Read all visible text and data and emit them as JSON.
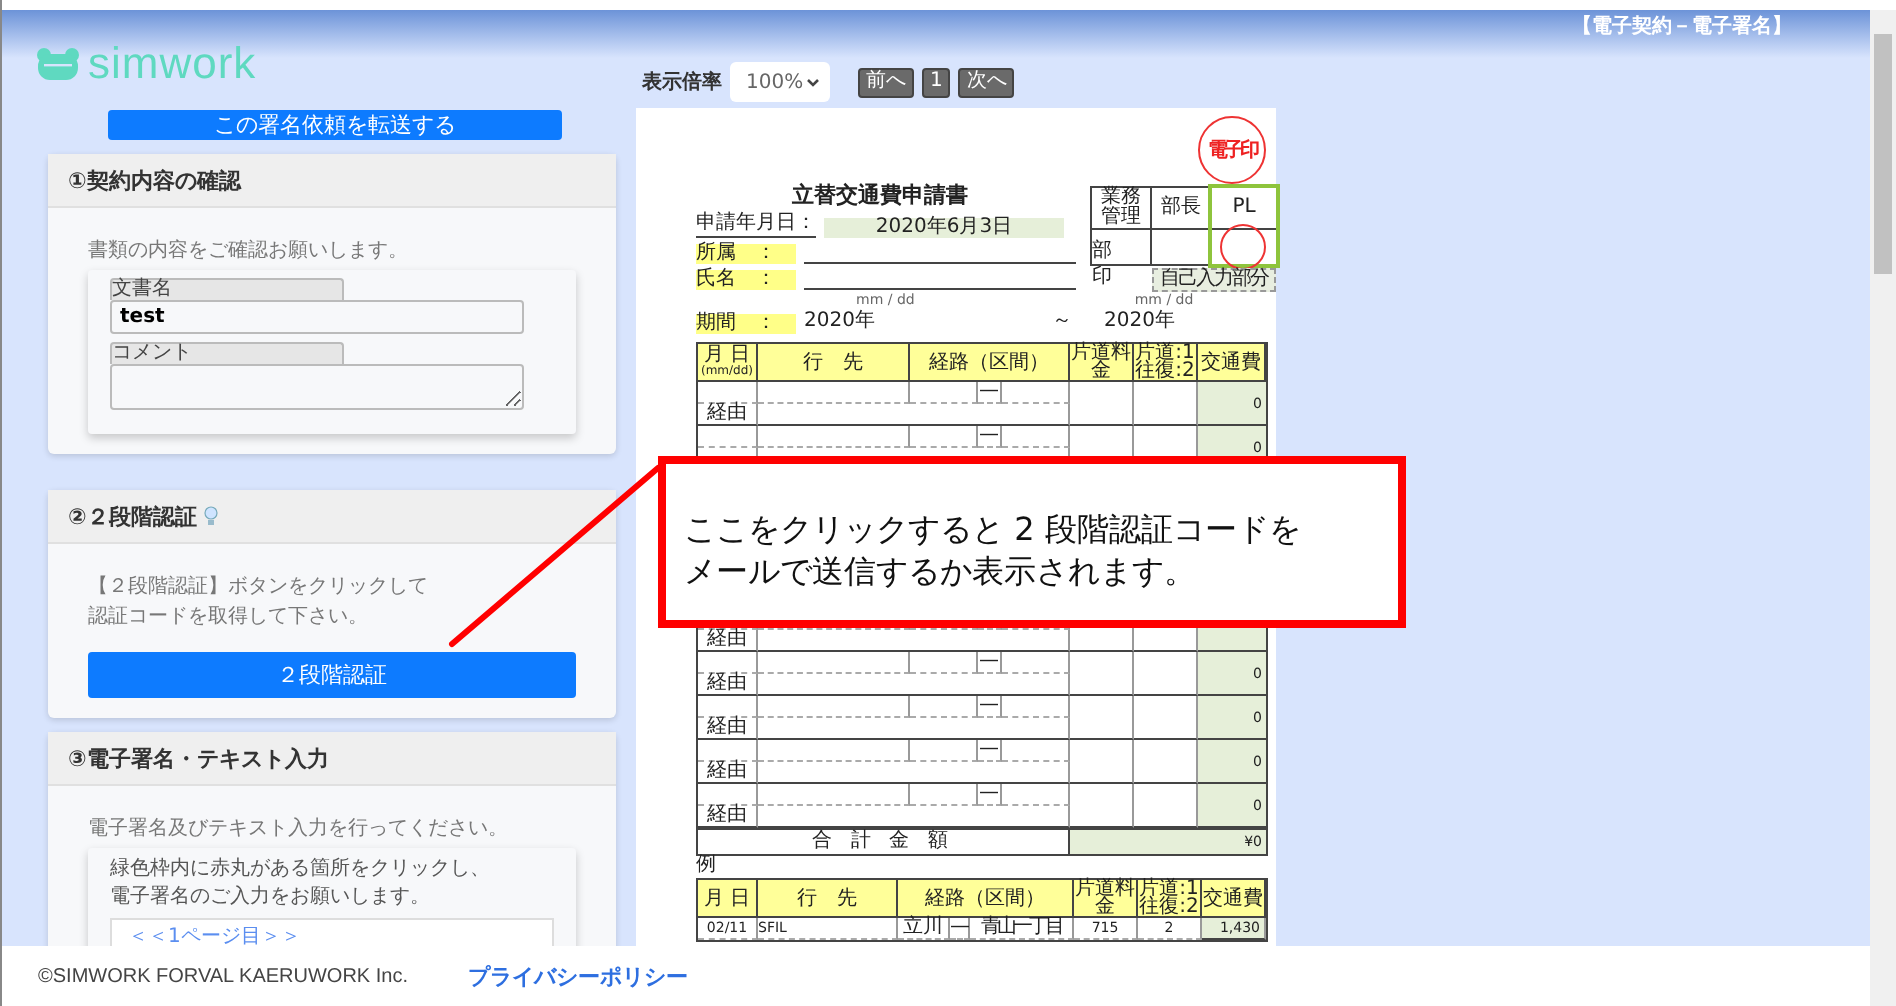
{
  "header": {
    "title": "【電子契約－電子署名】"
  },
  "logo": {
    "text": "simwork"
  },
  "transfer_button": "この署名依頼を転送する",
  "sections": [
    {
      "kind": "contract",
      "title": "①契約内容の確認",
      "intro": "書類の内容をご確認お願いします。",
      "fields": [
        {
          "label": "文書名",
          "value": "test"
        },
        {
          "label": "コメント"
        }
      ]
    },
    {
      "kind": "twofactor",
      "title": "②２段階認証",
      "lines": [
        "【２段階認証】ボタンをクリックして",
        "認証コードを取得して下さい。"
      ],
      "button": "２段階認証"
    },
    {
      "kind": "signature",
      "title": "③電子署名・テキスト入力",
      "intro": "電子署名及びテキスト入力を行ってください。",
      "notes": [
        "緑色枠内に赤丸がある箇所をクリックし、",
        "電子署名のご入力をお願いします。"
      ],
      "page_link": "＜＜1ページ目＞＞"
    }
  ],
  "viewer": {
    "zoom_label": "表示倍率",
    "zoom_value": "100%",
    "prev": "前へ",
    "page": "1",
    "next": "次へ"
  },
  "document": {
    "stamp": "電子印",
    "title": "立替交通費申請書",
    "approvals": [
      "業務管理",
      "部長",
      "PL"
    ],
    "self_input": "自己入力部分",
    "date_label": "申請年月日：",
    "date_value": "2020年6月3日",
    "dept_label": "所属　：",
    "dept_suffix": "部",
    "name_label": "氏名　：",
    "name_mark": "印",
    "date_hints": [
      "mm / dd",
      "mm / dd"
    ],
    "period_label": "期間　：",
    "period_from": "2020年",
    "period_sep": "～",
    "period_to": "2020年",
    "columns": [
      "月 日",
      "行　先",
      "経路（区間）",
      "片道料金",
      "片道:1 往復:2",
      "交通費"
    ],
    "date_format": "(mm/dd)",
    "rows_top": [
      {
        "dash": "—",
        "via": "経由",
        "amount": "0"
      },
      {
        "dash": "—",
        "amount": "0"
      }
    ],
    "rows_bottom": [
      {
        "via": "経由"
      },
      {
        "dash": "—",
        "via": "経由",
        "amount": "0"
      },
      {
        "dash": "—",
        "via": "経由",
        "amount": "0"
      },
      {
        "dash": "—",
        "via": "経由",
        "amount": "0"
      },
      {
        "dash": "—",
        "via": "経由",
        "amount": "0"
      }
    ],
    "total_label": "合 計 金 額",
    "total_value": "¥0",
    "example": {
      "label": "例",
      "columns": [
        "月 日",
        "行　先",
        "経路（区間）",
        "片道料金",
        "片道:1 往復:2",
        "交通費"
      ],
      "row": {
        "date": "02/11",
        "destination": "SFIL",
        "from": "立川",
        "dash": "—",
        "to": "青山一丁目",
        "fare": "715",
        "trips": "2",
        "amount": "1,430"
      }
    }
  },
  "callout": {
    "lines": [
      "ここをクリックすると 2 段階認証コードを",
      "メールで送信するか表示されます。"
    ]
  },
  "footer": {
    "copyright": "©SIMWORK FORVAL KAERUWORK Inc.",
    "privacy_link": "プライバシーポリシー"
  }
}
